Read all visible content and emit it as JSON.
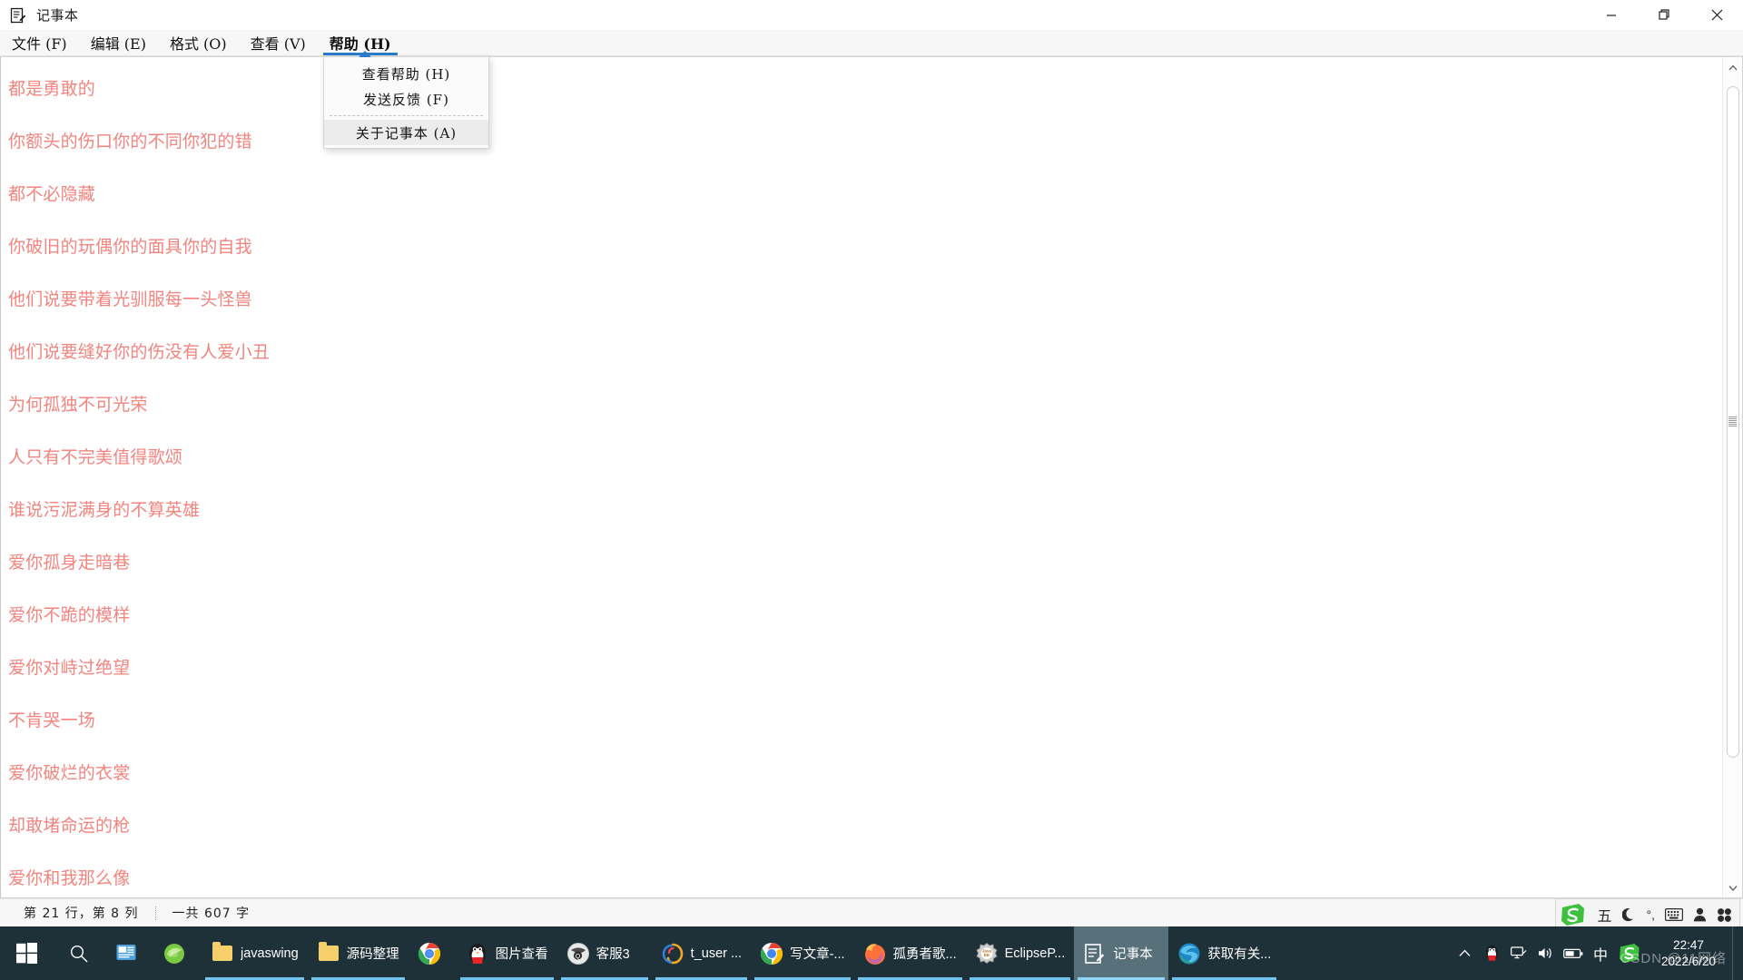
{
  "window": {
    "title": "记事本",
    "icon": "notepad-icon",
    "controls": {
      "minimize": "—",
      "maximize": "❐",
      "close": "✕"
    }
  },
  "menubar": {
    "items": [
      {
        "label": "文件 (F)",
        "name": "menu-file",
        "active": false
      },
      {
        "label": "编辑 (E)",
        "name": "menu-edit",
        "active": false
      },
      {
        "label": "格式 (O)",
        "name": "menu-format",
        "active": false
      },
      {
        "label": "查看 (V)",
        "name": "menu-view",
        "active": false
      },
      {
        "label": "帮助 (H)",
        "name": "menu-help",
        "active": true
      }
    ]
  },
  "help_menu": {
    "open": true,
    "items": [
      {
        "label": "查看帮助 (H)",
        "name": "menu-item-view-help",
        "highlighted": false
      },
      {
        "label": "发送反馈 (F)",
        "name": "menu-item-send-feedback",
        "highlighted": false
      },
      {
        "label": "关于记事本 (A)",
        "name": "menu-item-about-notepad",
        "highlighted": true
      }
    ]
  },
  "editor": {
    "text_color": "#f4847e",
    "lines": [
      "都是勇敢的",
      "你额头的伤口你的不同你犯的错",
      "都不必隐藏",
      "你破旧的玩偶你的面具你的自我",
      "他们说要带着光驯服每一头怪兽",
      "他们说要缝好你的伤没有人爱小丑",
      "为何孤独不可光荣",
      "人只有不完美值得歌颂",
      "谁说污泥满身的不算英雄",
      "爱你孤身走暗巷",
      "爱你不跪的模样",
      "爱你对峙过绝望",
      "不肯哭一场",
      "爱你破烂的衣裳",
      "却敢堵命运的枪",
      "爱你和我那么像"
    ]
  },
  "scrollbar": {
    "up_arrow": "⌃",
    "down_arrow": "⌄",
    "name": "vertical-scrollbar"
  },
  "statusbar": {
    "position": "第 21 行，第 8 列",
    "count": "一共 607 字"
  },
  "ime_bar": {
    "items": [
      {
        "label": "S",
        "name": "sogou-logo-icon"
      },
      {
        "label": "五",
        "name": "ime-mode-wubi-icon"
      },
      {
        "label": "☽",
        "name": "ime-moon-icon"
      },
      {
        "label": "°,",
        "name": "ime-punctuation-icon"
      },
      {
        "label": "⌨",
        "name": "ime-keyboard-icon"
      },
      {
        "label": "👤",
        "name": "ime-user-icon"
      },
      {
        "label": "❉",
        "name": "ime-toolbox-icon"
      }
    ]
  },
  "taskbar": {
    "start": {
      "name": "start-button",
      "label": ""
    },
    "search": {
      "name": "search-button",
      "label": ""
    },
    "taskview": {
      "name": "task-view-button",
      "label": ""
    },
    "buttons": [
      {
        "label": "",
        "icon": "wechat-green-icon",
        "name": "taskbar-wechat",
        "state": "pinned"
      },
      {
        "label": "javaswing",
        "icon": "folder-icon",
        "name": "taskbar-folder-javaswing",
        "state": "running"
      },
      {
        "label": "源码整理",
        "icon": "folder-icon",
        "name": "taskbar-folder-sourcecode",
        "state": "running"
      },
      {
        "label": "",
        "icon": "chrome-icon",
        "name": "taskbar-chrome",
        "state": "pinned"
      },
      {
        "label": "图片查看",
        "icon": "qq-penguin-icon",
        "name": "taskbar-image-viewer",
        "state": "running"
      },
      {
        "label": "客服3",
        "icon": "qq-group-icon",
        "name": "taskbar-customer-service",
        "state": "running"
      },
      {
        "label": "t_user ...",
        "icon": "navicat-icon",
        "name": "taskbar-navicat",
        "state": "running"
      },
      {
        "label": "写文章-...",
        "icon": "chrome-icon",
        "name": "taskbar-chrome-article",
        "state": "running"
      },
      {
        "label": "孤勇者歌...",
        "icon": "firefox-icon",
        "name": "taskbar-firefox-song",
        "state": "running"
      },
      {
        "label": "EclipseP...",
        "icon": "eclipse-icon",
        "name": "taskbar-eclipse",
        "state": "running"
      },
      {
        "label": "记事本",
        "icon": "notepad-icon",
        "name": "taskbar-notepad",
        "state": "active"
      },
      {
        "label": "获取有关...",
        "icon": "edge-icon",
        "name": "taskbar-edge",
        "state": "running"
      }
    ],
    "tray": [
      {
        "label": "︿",
        "name": "tray-show-hidden-icons"
      },
      {
        "label": "🐧",
        "name": "tray-qq-icon"
      },
      {
        "label": "🖧",
        "name": "tray-network-icon"
      },
      {
        "label": "🔊",
        "name": "tray-volume-icon"
      },
      {
        "label": "🔋",
        "name": "tray-battery-icon"
      },
      {
        "label": "中",
        "name": "tray-ime-chinese-icon"
      },
      {
        "label": "S",
        "name": "tray-sogou-icon"
      }
    ],
    "clock": {
      "time": "22:47",
      "date": "2022/6/20"
    }
  },
  "watermark": {
    "text": "CSDN @11网络"
  }
}
